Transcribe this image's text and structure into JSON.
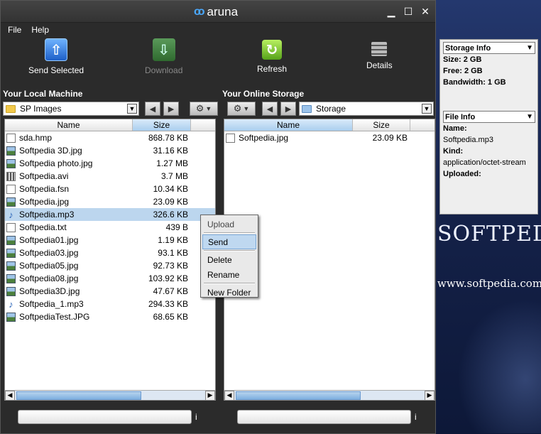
{
  "app": {
    "title": "aruna"
  },
  "menu": {
    "file": "File",
    "help": "Help"
  },
  "toolbar": {
    "send_selected": "Send Selected",
    "download": "Download",
    "refresh": "Refresh",
    "details": "Details"
  },
  "local": {
    "title": "Your Local Machine",
    "folder": "SP Images",
    "col_name": "Name",
    "col_size": "Size",
    "files": [
      {
        "name": "sda.hmp",
        "size": "868.78 KB",
        "icon": "file-icon"
      },
      {
        "name": "Softpedia 3D.jpg",
        "size": "31.16 KB",
        "icon": "image-icon"
      },
      {
        "name": "Softpedia photo.jpg",
        "size": "1.27 MB",
        "icon": "image-icon"
      },
      {
        "name": "Softpedia.avi",
        "size": "3.7 MB",
        "icon": "video-icon"
      },
      {
        "name": "Softpedia.fsn",
        "size": "10.34 KB",
        "icon": "file-icon"
      },
      {
        "name": "Softpedia.jpg",
        "size": "23.09 KB",
        "icon": "image-icon"
      },
      {
        "name": "Softpedia.mp3",
        "size": "326.6 KB",
        "icon": "audio-icon"
      },
      {
        "name": "Softpedia.txt",
        "size": "439 B",
        "icon": "file-icon"
      },
      {
        "name": "Softpedia01.jpg",
        "size": "1.19 KB",
        "icon": "image-icon"
      },
      {
        "name": "Softpedia03.jpg",
        "size": "93.1 KB",
        "icon": "image-icon"
      },
      {
        "name": "Softpedia05.jpg",
        "size": "92.73 KB",
        "icon": "image-icon"
      },
      {
        "name": "Softpedia08.jpg",
        "size": "103.92 KB",
        "icon": "image-icon"
      },
      {
        "name": "Softpedia3D.jpg",
        "size": "47.67 KB",
        "icon": "image-icon"
      },
      {
        "name": "Softpedia_1.mp3",
        "size": "294.33 KB",
        "icon": "audio-icon"
      },
      {
        "name": "SoftpediaTest.JPG",
        "size": "68.65 KB",
        "icon": "image-icon"
      }
    ]
  },
  "online": {
    "title": "Your Online Storage",
    "folder": "Storage",
    "col_name": "Name",
    "col_size": "Size",
    "files": [
      {
        "name": "Softpedia.jpg",
        "size": "23.09 KB",
        "icon": "file-icon"
      }
    ]
  },
  "context_menu": {
    "upload": "Upload",
    "send": "Send",
    "delete": "Delete",
    "rename": "Rename",
    "new_folder": "New Folder"
  },
  "status": {
    "info_left": "i",
    "info_right": "i"
  },
  "side": {
    "storage_info": "Storage Info",
    "size": "Size: 2 GB",
    "free": "Free: 2 GB",
    "bandwidth": "Bandwidth: 1 GB",
    "file_info": "File Info",
    "name_label": "Name:",
    "name_value": "Softpedia.mp3",
    "kind_label": "Kind:",
    "kind_value": "application/octet-stream",
    "uploaded_label": "Uploaded:"
  },
  "desktop": {
    "watermark": "SOFTPEDIA",
    "url": "www.softpedia.com"
  },
  "colors": {
    "accent": "#4aa9ff",
    "selection": "#bcd6ee",
    "window_bg": "#2b2b2b"
  }
}
